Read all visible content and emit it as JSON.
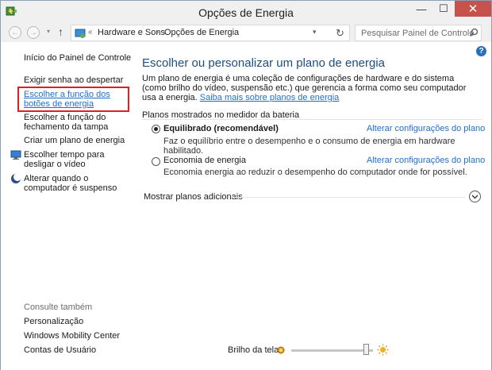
{
  "window": {
    "title": "Opções de Energia",
    "minimize": "—",
    "maximize": "☐",
    "close": "✕"
  },
  "nav": {
    "back": "←",
    "forward": "→",
    "history": "▾",
    "up": "↑",
    "crumb_chevron": "«",
    "breadcrumb": [
      "Hardware e Sons",
      "Opções de Energia"
    ],
    "crumb_sep": "›",
    "dropdown": "▾",
    "refresh": "↻",
    "search_placeholder": "Pesquisar Painel de Controle"
  },
  "sidebar": {
    "home": "Início do Painel de Controle",
    "items": [
      {
        "label": "Exigir senha ao despertar"
      },
      {
        "label": "Escolher a função dos botões de energia",
        "highlighted": true
      },
      {
        "label": "Escolher a função do fechamento da tampa"
      },
      {
        "label": "Criar um plano de energia"
      },
      {
        "label": "Escolher tempo para desligar o vídeo",
        "icon": "monitor-icon"
      },
      {
        "label": "Alterar quando o computador é suspenso",
        "icon": "moon-icon"
      }
    ],
    "see_also_title": "Consulte também",
    "see_also": [
      "Personalização",
      "Windows Mobility Center",
      "Contas de Usuário"
    ]
  },
  "main": {
    "help": "?",
    "title": "Escolher ou personalizar um plano de energia",
    "description": "Um plano de energia é uma coleção de configurações de hardware e do sistema (como brilho do vídeo, suspensão etc.) que gerencia a forma como seu computador usa a energia. ",
    "description_link": "Saiba mais sobre planos de energia",
    "section_title": "Planos mostrados no medidor da bateria",
    "plans": [
      {
        "name": "Equilibrado (recomendável)",
        "selected": true,
        "link": "Alterar configurações do plano",
        "description": "Faz o equilíbrio entre o desempenho e o consumo de energia em hardware habilitado."
      },
      {
        "name": "Economia de energia",
        "selected": false,
        "link": "Alterar configurações do plano",
        "description": "Economia energia ao reduzir o desempenho do computador onde for possível."
      }
    ],
    "more_plans": "Mostrar planos adicionais",
    "more_plans_icon": "chevron-down-icon"
  },
  "brightness": {
    "label": "Brilho da tela:",
    "level": 0.95
  },
  "colors": {
    "accent": "#1f6fce",
    "title": "#1c4e80",
    "close_button": "#c7514b",
    "highlight_border": "#e02020"
  }
}
